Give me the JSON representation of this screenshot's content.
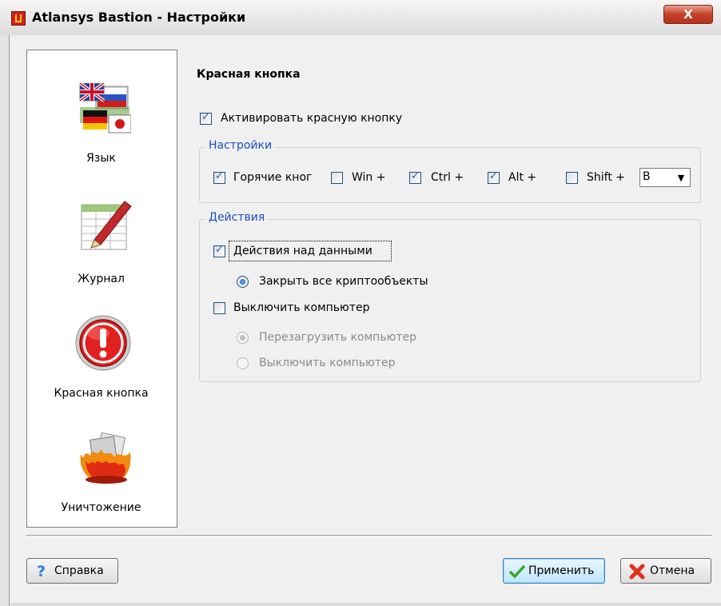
{
  "window": {
    "title": "Atlansys Bastion - Настройки",
    "close_label": "X"
  },
  "sidebar": {
    "items": [
      {
        "label": "Язык",
        "icon": "flags-icon"
      },
      {
        "label": "Журнал",
        "icon": "journal-pen-icon"
      },
      {
        "label": "Красная кнопка",
        "icon": "red-alert-icon"
      },
      {
        "label": "Уничтожение",
        "icon": "fire-documents-icon"
      }
    ],
    "selected": "Красная кнопка"
  },
  "content": {
    "heading": "Красная кнопка",
    "activate": {
      "label": "Активировать красную кнопку",
      "checked": true
    },
    "settings_group": {
      "title": "Настройки",
      "hotkey": {
        "label": "Горячие кног",
        "checked": true
      },
      "win": {
        "label": "Win +",
        "checked": false
      },
      "ctrl": {
        "label": "Ctrl +",
        "checked": true
      },
      "alt": {
        "label": "Alt +",
        "checked": true
      },
      "shift": {
        "label": "Shift +",
        "checked": false
      },
      "key_value": "B"
    },
    "actions_group": {
      "title": "Действия",
      "data_actions": {
        "label": "Действия над данными",
        "checked": true
      },
      "close_crypto": {
        "label": "Закрыть все криптообъекты",
        "selected": true
      },
      "shutdown": {
        "label": "Выключить компьютер",
        "checked": false
      },
      "restart_option": {
        "label": "Перезагрузить компьютер",
        "selected": true,
        "disabled": true
      },
      "poweroff_option": {
        "label": "Выключить компьютер",
        "selected": false,
        "disabled": true
      }
    }
  },
  "buttons": {
    "help": "Справка",
    "apply": "Применить",
    "cancel": "Отмена"
  },
  "colors": {
    "group_title": "#1a4fc9",
    "alert_red": "#d42020",
    "apply_border": "#3c7fb1"
  }
}
